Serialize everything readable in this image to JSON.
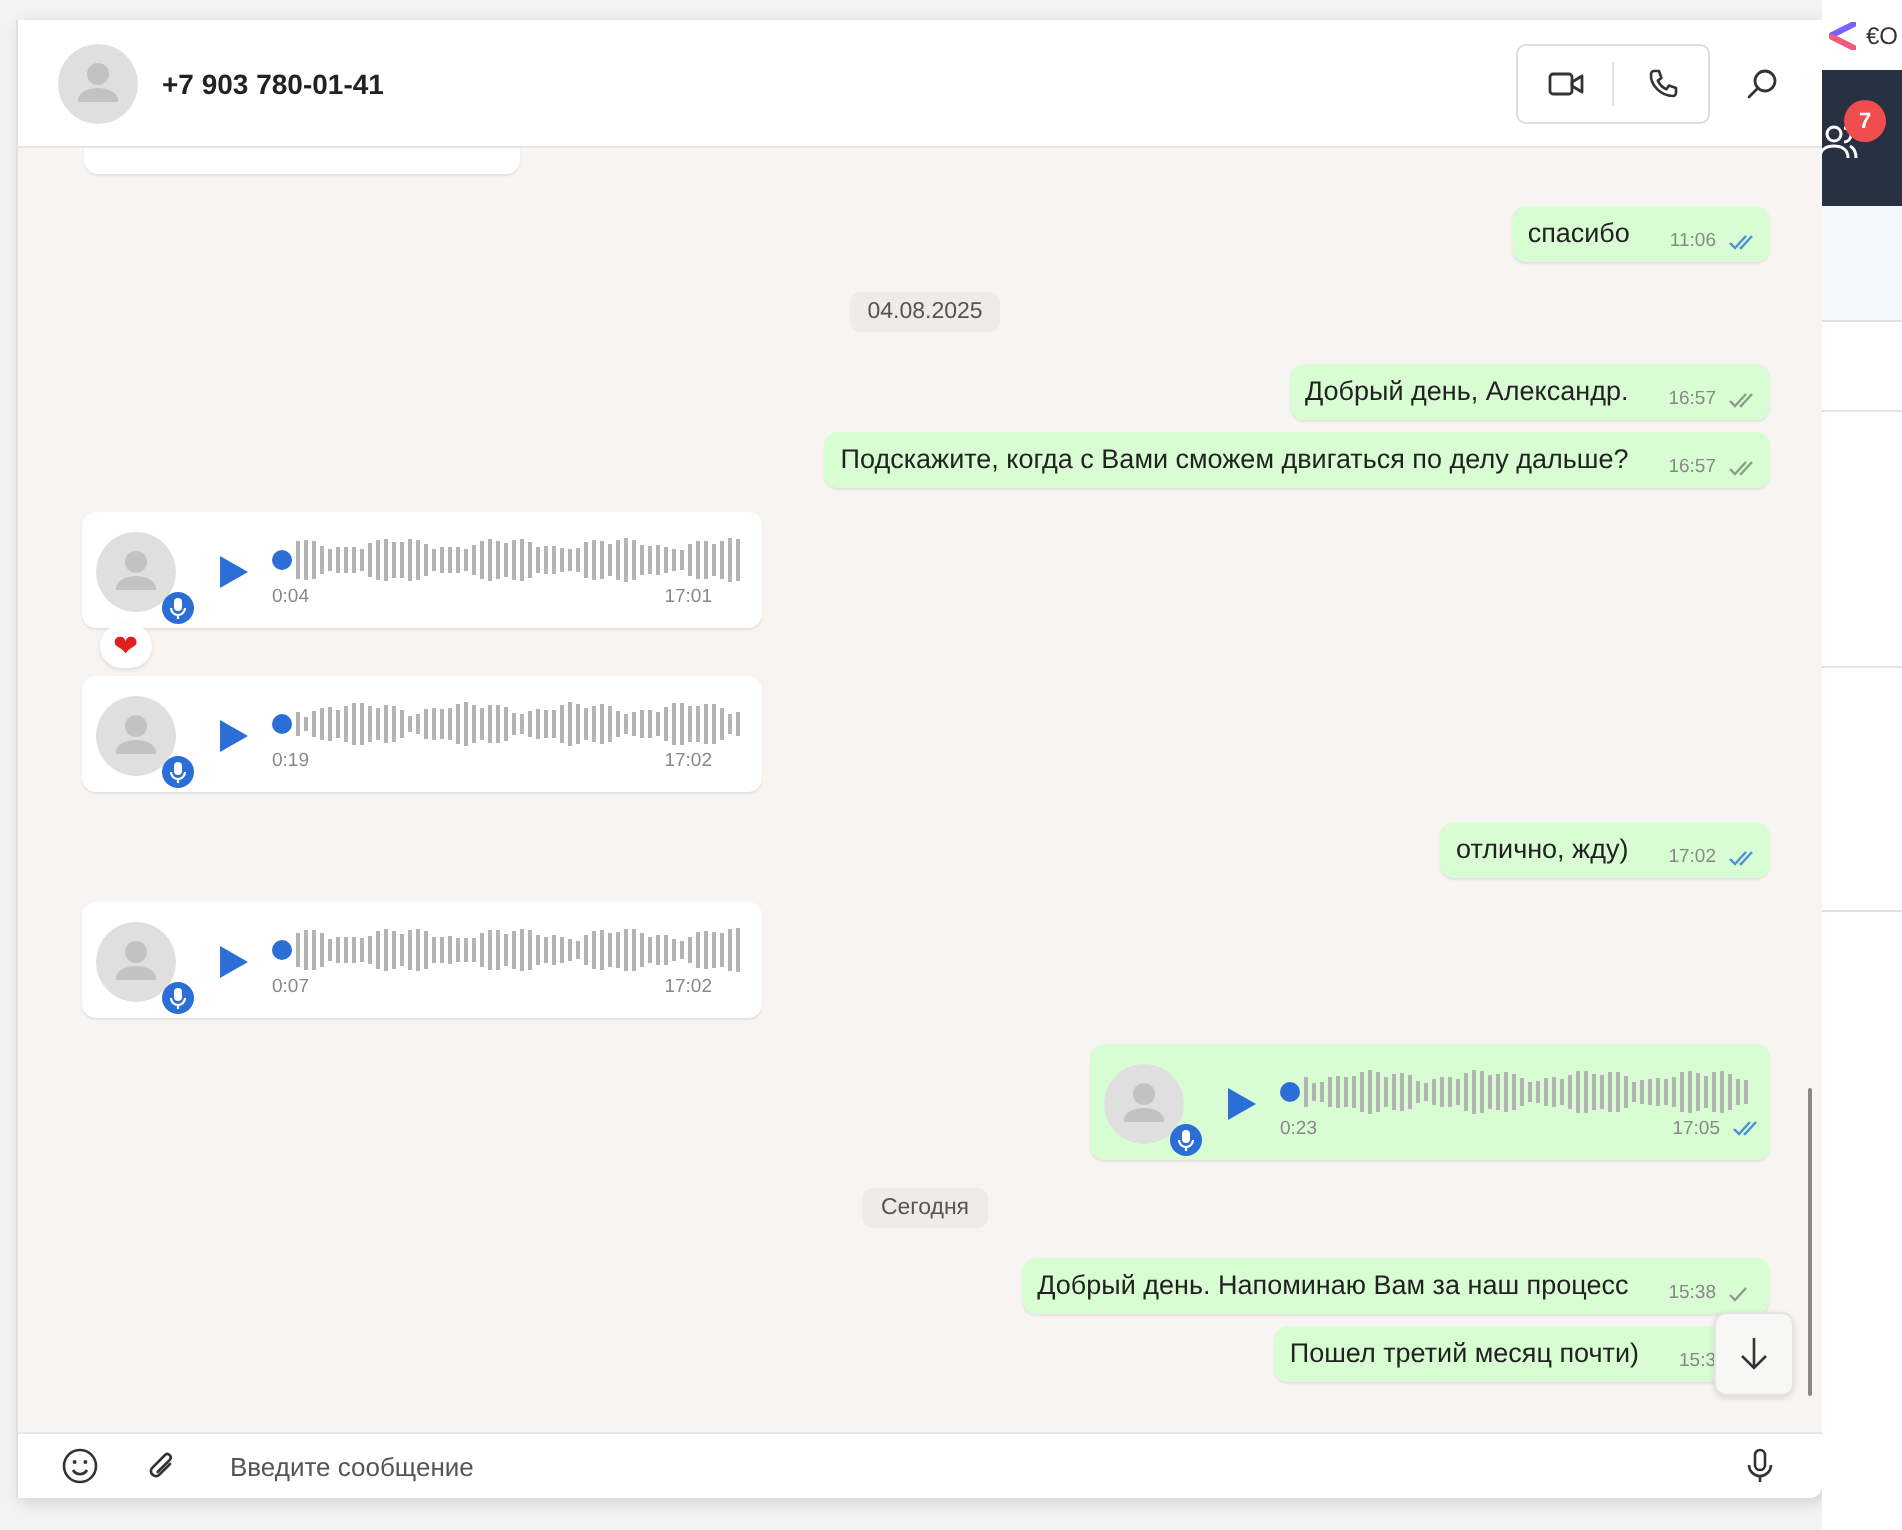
{
  "contact": {
    "name": "+7 903 780-01-41"
  },
  "messages": [
    {
      "kind": "clipped",
      "outgoing": false
    },
    {
      "kind": "text",
      "outgoing": true,
      "text": "спасибо",
      "time": "11:06",
      "delivered": true,
      "read": true
    },
    {
      "kind": "date",
      "text": "04.08.2025"
    },
    {
      "kind": "text",
      "outgoing": true,
      "text": "Добрый день, Александр.",
      "time": "16:57",
      "delivered": true,
      "read": false
    },
    {
      "kind": "text",
      "outgoing": true,
      "text": "Подскажите, когда с Вами сможем двигаться по делу дальше?",
      "time": "16:57",
      "delivered": true,
      "read": false
    },
    {
      "kind": "voice",
      "outgoing": false,
      "duration": "0:04",
      "time": "17:01",
      "reaction": "❤"
    },
    {
      "kind": "voice",
      "outgoing": false,
      "duration": "0:19",
      "time": "17:02"
    },
    {
      "kind": "text",
      "outgoing": true,
      "text": "отлично, жду)",
      "time": "17:02",
      "delivered": true,
      "read": true
    },
    {
      "kind": "voice",
      "outgoing": false,
      "duration": "0:07",
      "time": "17:02"
    },
    {
      "kind": "voice",
      "outgoing": true,
      "duration": "0:23",
      "time": "17:05",
      "delivered": true,
      "read": true
    },
    {
      "kind": "date",
      "text": "Сегодня"
    },
    {
      "kind": "text",
      "outgoing": true,
      "text": "Добрый день. Напоминаю Вам за наш процесс",
      "time": "15:38",
      "delivered": false,
      "read": false
    },
    {
      "kind": "text",
      "outgoing": true,
      "text": "Пошел третий месяц почти)",
      "time": "15:3"
    }
  ],
  "composer": {
    "placeholder": "Введите сообщение"
  },
  "side": {
    "brand": "€O",
    "badge": "7"
  }
}
